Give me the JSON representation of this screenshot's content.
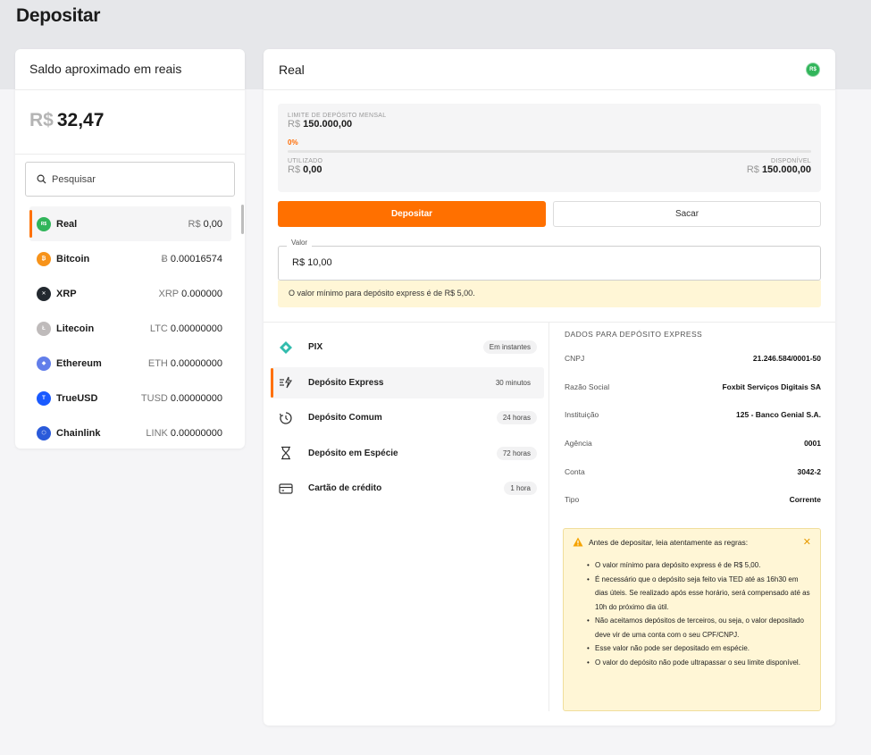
{
  "page": {
    "title": "Depositar"
  },
  "left_card": {
    "header": "Saldo aproximado em reais",
    "balance_currency": "R$",
    "balance_value": "32,47",
    "search_placeholder": "Pesquisar",
    "assets": [
      {
        "name": "Real",
        "unit": "R$",
        "amount": "0,00",
        "icon": "real-icon",
        "color": "#31b55a",
        "glyph": "R$"
      },
      {
        "name": "Bitcoin",
        "unit": "Ƀ",
        "amount": "0.00016574",
        "icon": "bitcoin-icon",
        "color": "#f7931a",
        "glyph": "₿"
      },
      {
        "name": "XRP",
        "unit": "XRP",
        "amount": "0.000000",
        "icon": "xrp-icon",
        "color": "#23292f",
        "glyph": "✕"
      },
      {
        "name": "Litecoin",
        "unit": "LTC",
        "amount": "0.00000000",
        "icon": "litecoin-icon",
        "color": "#bfbbbb",
        "glyph": "Ł"
      },
      {
        "name": "Ethereum",
        "unit": "ETH",
        "amount": "0.00000000",
        "icon": "ethereum-icon",
        "color": "#627eea",
        "glyph": "◆"
      },
      {
        "name": "TrueUSD",
        "unit": "TUSD",
        "amount": "0.00000000",
        "icon": "trueusd-icon",
        "color": "#1a5aff",
        "glyph": "T"
      },
      {
        "name": "Chainlink",
        "unit": "LINK",
        "amount": "0.00000000",
        "icon": "chainlink-icon",
        "color": "#2a5ada",
        "glyph": "⬡"
      }
    ]
  },
  "main_card": {
    "header": "Real",
    "header_badge": "R$",
    "limit": {
      "title": "LIMITE DE DEPÓSITO MENSAL",
      "total_unit": "R$",
      "total_value": "150.000,00",
      "percent_label": "0%",
      "percent_used": 0,
      "used_label": "UTILIZADO",
      "used_unit": "R$",
      "used_value": "0,00",
      "available_label": "DISPONÍVEL",
      "available_unit": "R$",
      "available_value": "150.000,00"
    },
    "buttons": {
      "deposit": "Depositar",
      "withdraw": "Sacar"
    },
    "valor": {
      "label": "Valor",
      "value": "R$ 10,00"
    },
    "min_note": "O valor mínimo para depósito express é de R$ 5,00.",
    "methods": [
      {
        "name": "PIX",
        "time": "Em instantes",
        "icon": "pix-icon",
        "active": false
      },
      {
        "name": "Depósito Express",
        "time": "30 minutos",
        "icon": "express-icon",
        "active": true
      },
      {
        "name": "Depósito Comum",
        "time": "24 horas",
        "icon": "clock-icon",
        "active": false
      },
      {
        "name": "Depósito em Espécie",
        "time": "72 horas",
        "icon": "hourglass-icon",
        "active": false
      },
      {
        "name": "Cartão de crédito",
        "time": "1 hora",
        "icon": "credit-card-icon",
        "active": false
      }
    ],
    "details": {
      "title": "DADOS PARA DEPÓSITO EXPRESS",
      "rows": [
        {
          "k": "CNPJ",
          "v": "21.246.584/0001-50"
        },
        {
          "k": "Razão Social",
          "v": "Foxbit Serviços Digitais SA"
        },
        {
          "k": "Instituição",
          "v": "125 - Banco Genial S.A."
        },
        {
          "k": "Agência",
          "v": "0001"
        },
        {
          "k": "Conta",
          "v": "3042-2"
        },
        {
          "k": "Tipo",
          "v": "Corrente"
        }
      ]
    },
    "rules": {
      "title": "Antes de depositar, leia atentamente as regras:",
      "items": [
        "O valor mínimo para depósito express é de R$ 5,00.",
        "É necessário que o depósito seja feito via TED até as 16h30 em dias úteis. Se realizado após esse horário, será compensado até as 10h do próximo dia útil.",
        "Não aceitamos depósitos de terceiros, ou seja, o valor depositado deve vir de uma conta com o seu CPF/CNPJ.",
        "Esse valor não pode ser depositado em espécie.",
        "O valor do depósito não pode ultrapassar o seu limite disponível."
      ]
    }
  }
}
